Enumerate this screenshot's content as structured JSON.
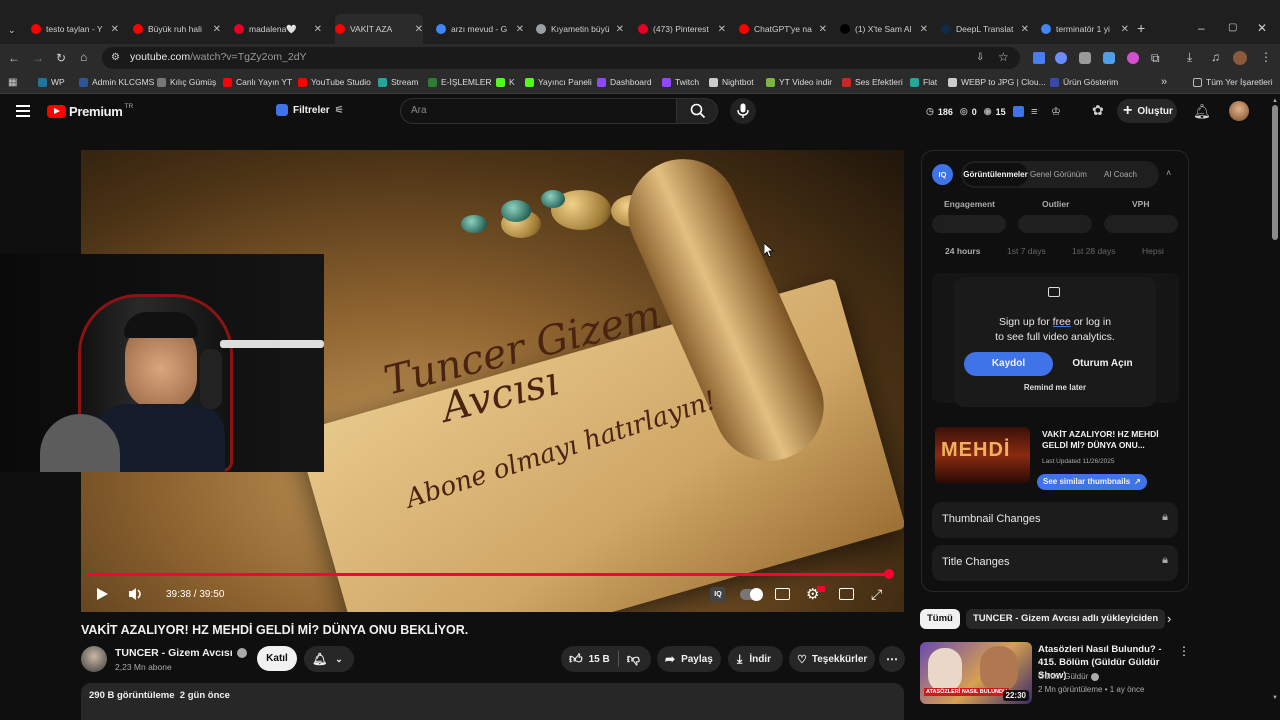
{
  "browser": {
    "tabs": [
      {
        "label": "testo taylan - Y",
        "favicon_color": "#ff0000"
      },
      {
        "label": "Büyük ruh hali",
        "favicon_color": "#ff0000"
      },
      {
        "label": "madalena🤍",
        "favicon_color": "#e60023"
      },
      {
        "label": "VAKİT AZA",
        "favicon_color": "#ff0000"
      },
      {
        "label": "arzı mevud - G",
        "favicon_color": "#4285f4"
      },
      {
        "label": "Kıyametin büyü",
        "favicon_color": "#9aa0a6"
      },
      {
        "label": "(473) Pinterest",
        "favicon_color": "#e60023"
      },
      {
        "label": "ChatGPT'ye na",
        "favicon_color": "#ff0000"
      },
      {
        "label": "(1) X'te Sam Al",
        "favicon_color": "#000000"
      },
      {
        "label": "DeepL Translat",
        "favicon_color": "#0f2b46"
      },
      {
        "label": "terminatör 1 yi",
        "favicon_color": "#4285f4"
      }
    ],
    "new_tab": "+",
    "url_host": "youtube.com",
    "url_path": "/watch?v=TgZy2om_2dY",
    "bookmarks": [
      {
        "label": "WP",
        "icon_color": "#21759b"
      },
      {
        "label": "Admin KLCGMS",
        "icon_color": "#2b579a"
      },
      {
        "label": "Kılıç Gümüş",
        "icon_color": "#777777"
      },
      {
        "label": "Canlı Yayın YT",
        "icon_color": "#ff0000"
      },
      {
        "label": "YouTube Studio",
        "icon_color": "#ff0000"
      },
      {
        "label": "Stream",
        "icon_color": "#26a69a"
      },
      {
        "label": "E-İŞLEMLER",
        "icon_color": "#2e7d32"
      },
      {
        "label": "K",
        "icon_color": "#53fc18"
      },
      {
        "label": "Yayıncı Paneli",
        "icon_color": "#53fc18"
      },
      {
        "label": "Dashboard",
        "icon_color": "#9146ff"
      },
      {
        "label": "Twitch",
        "icon_color": "#9146ff"
      },
      {
        "label": "Nightbot",
        "icon_color": "#cccccc"
      },
      {
        "label": "YT Video indir",
        "icon_color": "#7cb342"
      },
      {
        "label": "Ses Efektleri",
        "icon_color": "#c62828"
      },
      {
        "label": "Flat",
        "icon_color": "#26a69a"
      },
      {
        "label": "WEBP to JPG | Clou...",
        "icon_color": "#cccccc"
      },
      {
        "label": "Ürün Gösterim",
        "icon_color": "#3949ab"
      }
    ],
    "all_bookmarks": "Tüm Yer İşaretleri"
  },
  "header": {
    "logo_text": "Premium",
    "logo_region": "TR",
    "filters_label": "Filtreler",
    "search_placeholder": "Ara",
    "stats": [
      "186",
      "0",
      "15"
    ],
    "create_label": "Oluştur"
  },
  "video": {
    "scroll_title_1": "Tuncer Gizem",
    "scroll_title_2": "Avcısı",
    "scroll_subtitle": "Abone olmayı hatırlayın!",
    "time": "39:38 / 39:50",
    "progress": 0.995,
    "title": "VAKİT AZALIYOR! HZ MEHDİ GELDİ Mİ? DÜNYA ONU BEKLİYOR.",
    "channel": "TUNCER - Gizem Avcısı",
    "subs": "2,23 Mn abone",
    "join": "Katıl",
    "likes": "15 B",
    "share": "Paylaş",
    "download": "İndir",
    "thanks": "Teşekkürler",
    "views_line": "290 B görüntüleme  2 gün önce"
  },
  "iq_panel": {
    "logo": "IQ",
    "tabs": [
      "Görüntülenmeler",
      "Genel Görünüm",
      "AI Coach"
    ],
    "metrics": [
      "Engagement",
      "Outlier",
      "VPH"
    ],
    "ranges": [
      "24 hours",
      "1st 7 days",
      "1st 28 days",
      "Hepsi"
    ],
    "signup_text_1": "Sign up for",
    "signup_free": "free",
    "signup_text_2": "or log in",
    "signup_text_3": "to see full video analytics.",
    "register": "Kaydol",
    "login": "Oturum Açın",
    "remind": "Remind me later",
    "thumb_title": "VAKİT AZALIYOR! HZ MEHDİ GELDİ Mİ? DÜNYA ONU...",
    "thumb_text": "MEHDİ",
    "thumb_updated": "Last Updated 11/26/2025",
    "similar": "See similar thumbnails",
    "thumbnail_changes": "Thumbnail Changes",
    "title_changes": "Title Changes"
  },
  "recommendations": {
    "chips": [
      "Tümü",
      "TUNCER - Gizem Avcısı adlı yükleyiciden"
    ],
    "items": [
      {
        "title": "Atasözleri Nasıl Bulundu? - 415. Bölüm (Güldür Güldür Show)",
        "channel": "Güldür Güldür",
        "meta": "2 Mn görüntüleme • 1 ay önce",
        "duration": "22:30",
        "thumb_caption": "ATASÖZLERİ NASIL BULUNDU"
      }
    ]
  }
}
